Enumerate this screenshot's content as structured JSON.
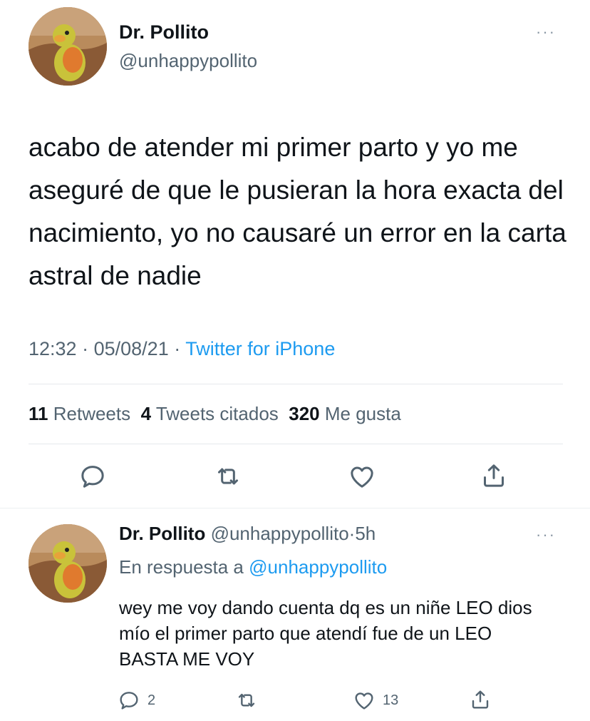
{
  "main_tweet": {
    "display_name": "Dr. Pollito",
    "handle": "@unhappypollito",
    "text": "acabo de atender mi primer parto y yo me aseguré de que le pusieran la hora exacta del nacimiento, yo no causaré un error en la carta astral de nadie",
    "time": "12:32",
    "date": "05/08/21",
    "source": "Twitter for iPhone",
    "more_label": "···",
    "stats": {
      "retweets_count": "11",
      "retweets_label": "Retweets",
      "quotes_count": "4",
      "quotes_label": "Tweets citados",
      "likes_count": "320",
      "likes_label": "Me gusta"
    }
  },
  "reply_tweet": {
    "display_name": "Dr. Pollito",
    "handle": "@unhappypollito",
    "time_ago": "5h",
    "replying_to_label": "En respuesta a",
    "replying_to_handle": "@unhappypollito",
    "text": "wey me voy dando cuenta dq es un niñe LEO dios mío el primer parto que atendí fue de un LEO BASTA ME VOY",
    "more_label": "···",
    "reply_count": "2",
    "like_count": "13"
  },
  "separator": "·",
  "icons": [
    "reply-icon",
    "retweet-icon",
    "like-icon",
    "share-icon"
  ],
  "colors": {
    "link": "#1d9bf0",
    "muted": "#536471",
    "text": "#0f1419",
    "divider": "#e6e9ec"
  }
}
